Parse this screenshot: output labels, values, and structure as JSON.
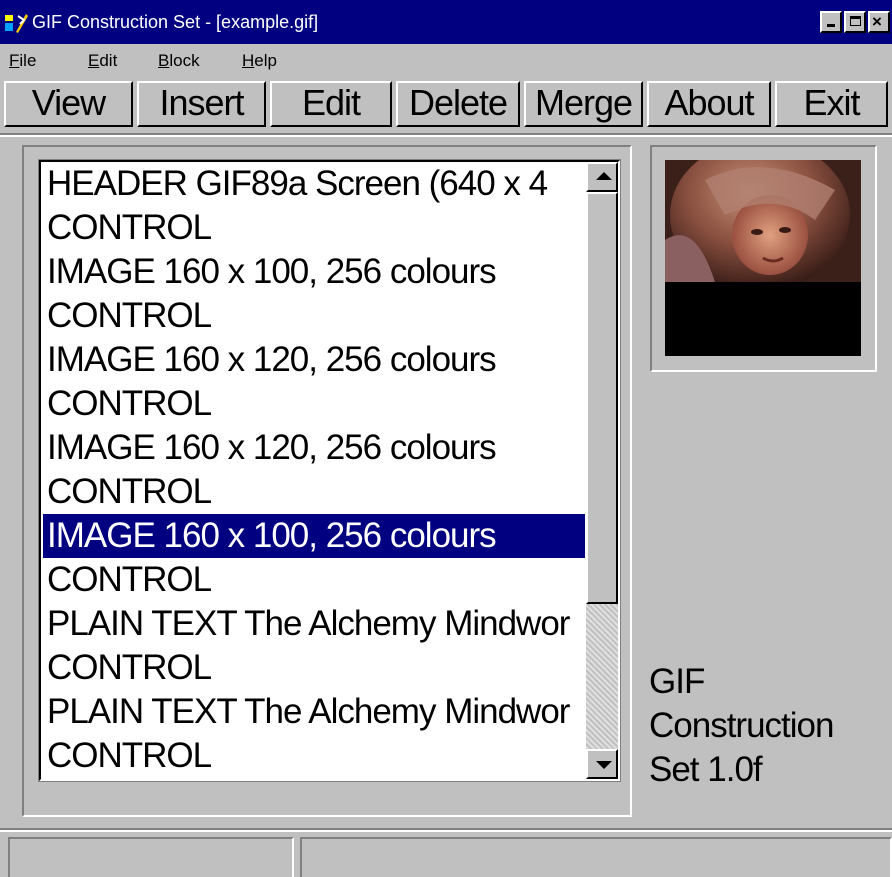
{
  "window": {
    "title": "GIF Construction Set - [example.gif]",
    "app_icon": "gif-construction-set-icon"
  },
  "menu": [
    {
      "label": "File"
    },
    {
      "label": "Edit"
    },
    {
      "label": "Block"
    },
    {
      "label": "Help"
    }
  ],
  "toolbar": {
    "buttons": [
      {
        "label": "View"
      },
      {
        "label": "Insert"
      },
      {
        "label": "Edit"
      },
      {
        "label": "Delete"
      },
      {
        "label": "Merge"
      },
      {
        "label": "About"
      },
      {
        "label": "Exit"
      }
    ]
  },
  "block_list": {
    "selected_index": 8,
    "items": [
      {
        "label": "HEADER GIF89a Screen (640 x 4"
      },
      {
        "label": "CONTROL"
      },
      {
        "label": "IMAGE 160 x 100, 256 colours"
      },
      {
        "label": "CONTROL"
      },
      {
        "label": "IMAGE 160 x 120, 256 colours"
      },
      {
        "label": "CONTROL"
      },
      {
        "label": "IMAGE 160 x 120, 256 colours"
      },
      {
        "label": "CONTROL"
      },
      {
        "label": "IMAGE 160 x 100, 256 colours"
      },
      {
        "label": "CONTROL"
      },
      {
        "label": "PLAIN TEXT The Alchemy Mindwor"
      },
      {
        "label": "CONTROL"
      },
      {
        "label": "PLAIN TEXT The Alchemy Mindwor"
      },
      {
        "label": "CONTROL"
      }
    ]
  },
  "preview": {
    "alt": "thumbnail-of-selected-image"
  },
  "app_version": "GIF Construction Set 1.0f",
  "status_bar": {
    "left": "",
    "right": ""
  },
  "colors": {
    "title_bar": "#000080",
    "selection": "#000080",
    "face": "#c0c0c0"
  }
}
